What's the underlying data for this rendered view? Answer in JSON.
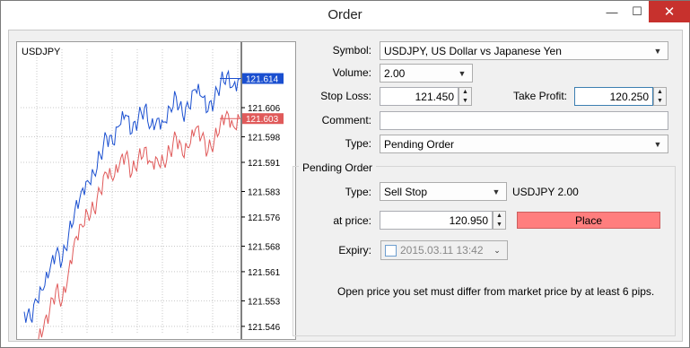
{
  "window": {
    "title": "Order",
    "minimize_icon": "minimize-icon",
    "maximize_icon": "maximize-icon",
    "close_icon": "close-icon"
  },
  "chart": {
    "symbol": "USDJPY",
    "price_labels": [
      "121.606",
      "121.598",
      "121.591",
      "121.583",
      "121.576",
      "121.568",
      "121.561",
      "121.553",
      "121.546"
    ],
    "bid_label": "121.614",
    "ask_label": "121.603",
    "colors": {
      "bid": "#1a4fd0",
      "ask": "#e05a5a",
      "bid_tag": "#1a4fd0",
      "ask_tag": "#e05a5a"
    }
  },
  "chart_data": {
    "type": "line",
    "y_range": [
      121.546,
      121.614
    ],
    "series": [
      {
        "values": [
          121.55,
          121.548,
          121.553,
          121.556,
          121.561,
          121.566,
          121.564,
          121.571,
          121.578,
          121.583,
          121.586,
          121.588,
          121.593,
          121.598,
          121.596,
          121.601,
          121.604,
          121.599,
          121.603,
          121.606,
          121.601,
          121.603,
          121.602,
          121.606,
          121.609,
          121.604,
          121.606,
          121.611,
          121.609,
          121.605,
          121.608,
          121.613,
          121.615,
          121.612,
          121.614
        ]
      },
      {
        "values": [
          121.538,
          121.536,
          121.541,
          121.545,
          121.55,
          121.556,
          121.553,
          121.561,
          121.57,
          121.574,
          121.577,
          121.578,
          121.583,
          121.588,
          121.586,
          121.59,
          121.593,
          121.588,
          121.592,
          121.595,
          121.591,
          121.592,
          121.591,
          121.594,
          121.598,
          121.593,
          121.595,
          121.6,
          121.598,
          121.594,
          121.597,
          121.602,
          121.605,
          121.601,
          121.603
        ]
      }
    ]
  },
  "form": {
    "symbol_label": "Symbol:",
    "symbol_value": "USDJPY, US Dollar vs Japanese Yen",
    "volume_label": "Volume:",
    "volume_value": "2.00",
    "stoploss_label": "Stop Loss:",
    "stoploss_value": "121.450",
    "takeprofit_label": "Take Profit:",
    "takeprofit_value": "120.250",
    "comment_label": "Comment:",
    "comment_value": "",
    "type_label": "Type:",
    "type_value": "Pending Order"
  },
  "pending": {
    "caption": "Pending Order",
    "type_label": "Type:",
    "type_value": "Sell Stop",
    "type_info": "USDJPY 2.00",
    "atprice_label": "at price:",
    "atprice_value": "120.950",
    "place_label": "Place",
    "place_color": "#ff7e7e",
    "expiry_label": "Expiry:",
    "expiry_value": "2015.03.11 13:42",
    "note": "Open price you set must differ from market price by at least 6 pips."
  }
}
